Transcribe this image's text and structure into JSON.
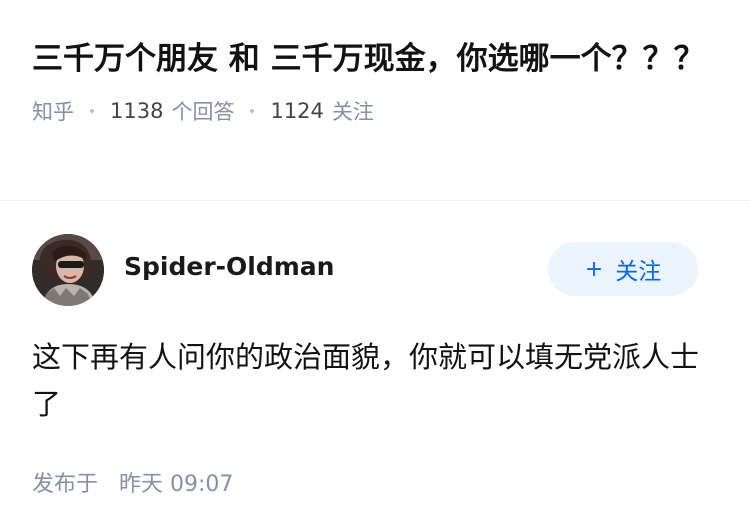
{
  "question": {
    "title": "三千万个朋友 和 三千万现金，你选哪一个？？？",
    "source": "知乎",
    "answer_count": "1138",
    "answer_label": "个回答",
    "follower_count": "1124",
    "follower_label": "关注"
  },
  "author": {
    "name": "Spider-Oldman",
    "avatar_icon": "user-avatar",
    "follow_label": "关注",
    "follow_icon": "plus-icon",
    "accent_color": "#0066ff"
  },
  "answer": {
    "text": "这下再有人问你的政治面貌，你就可以填无党派人士了"
  },
  "publish": {
    "label": "发布于",
    "time": "昨天 09:07"
  }
}
